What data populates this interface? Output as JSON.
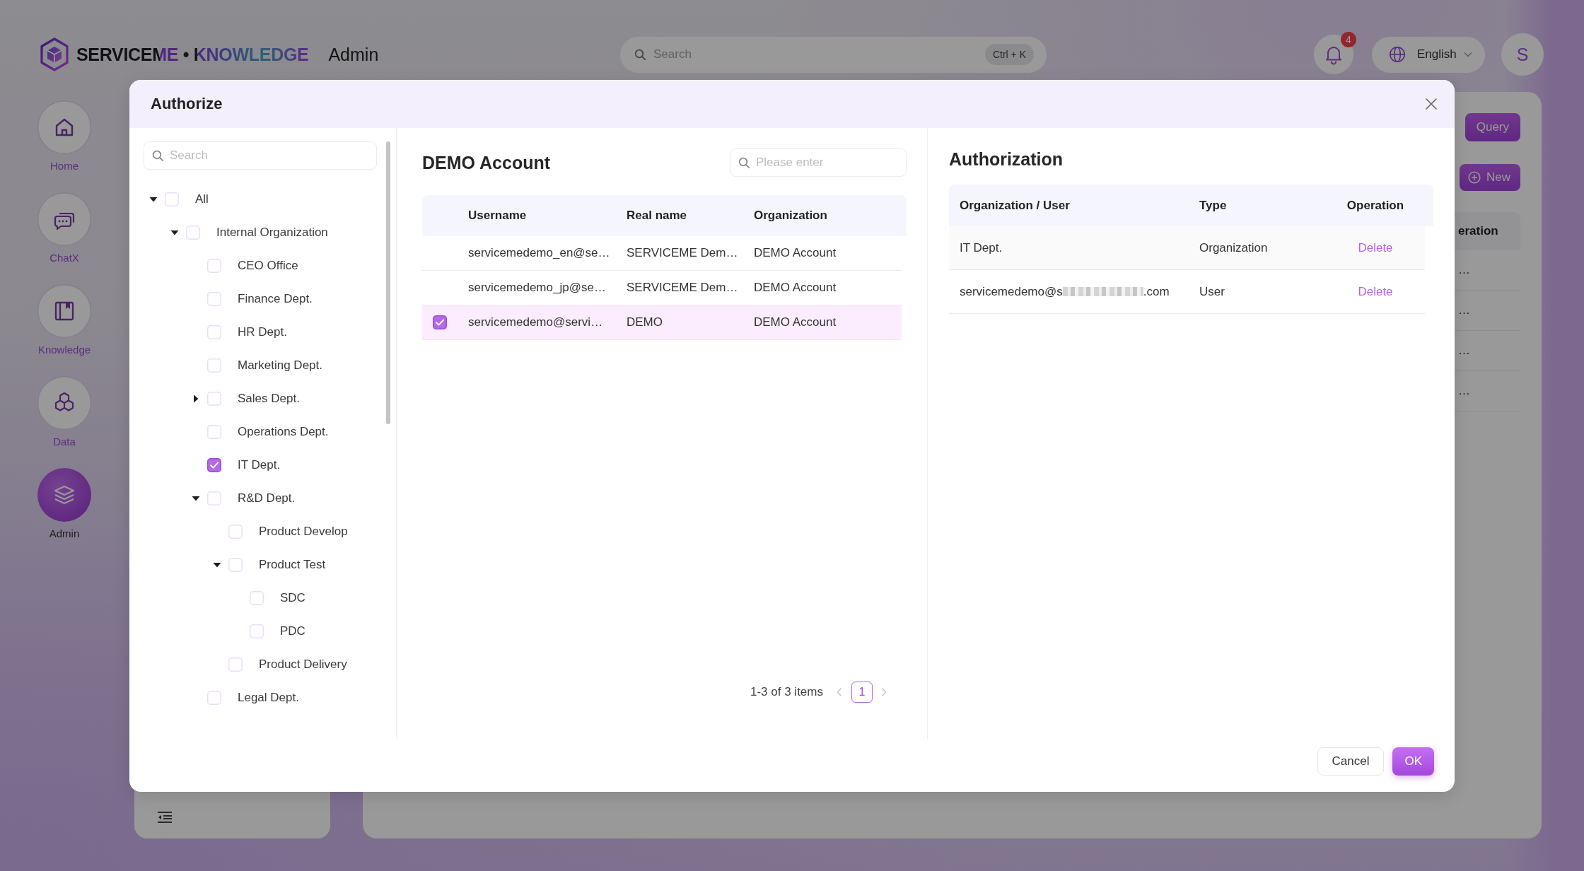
{
  "header": {
    "logo": "SERVICEME • KNOWLEDGE",
    "section": "Admin",
    "search": {
      "placeholder": "Search",
      "shortcut": "Ctrl + K"
    },
    "notifications": {
      "count": "4"
    },
    "language": {
      "label": "English"
    },
    "avatar": {
      "initial": "S"
    }
  },
  "nav": [
    {
      "label": "Home",
      "kind": "home",
      "selected": false
    },
    {
      "label": "ChatX",
      "kind": "chat",
      "selected": false
    },
    {
      "label": "Knowledge",
      "kind": "book",
      "selected": false
    },
    {
      "label": "Data",
      "kind": "hexagons",
      "selected": false
    },
    {
      "label": "Admin",
      "kind": "layers",
      "selected": true
    }
  ],
  "main_panel": {
    "buttons": [
      {
        "label": "Query",
        "kind": "query"
      },
      {
        "label": "New",
        "kind": "create"
      }
    ],
    "table": {
      "column_last": "eration",
      "rows": [
        {
          "column_last": "…"
        },
        {
          "column_last": "…"
        },
        {
          "column_last": "…"
        },
        {
          "column_last": "…"
        }
      ]
    }
  },
  "dialog": {
    "title": "Authorize",
    "tree": {
      "search": {
        "placeholder": "Search"
      },
      "nodes": [
        {
          "label": "All",
          "kind": "branch",
          "expanded": true,
          "checked": false,
          "children": [
            {
              "label": "Internal Organization",
              "kind": "branch",
              "expanded": true,
              "checked": false,
              "children": [
                {
                  "label": "CEO Office",
                  "kind": "leaf",
                  "checked": false
                },
                {
                  "label": "Finance Dept.",
                  "kind": "leaf",
                  "checked": false
                },
                {
                  "label": "HR Dept.",
                  "kind": "leaf",
                  "checked": false
                },
                {
                  "label": "Marketing Dept.",
                  "kind": "leaf",
                  "checked": false
                },
                {
                  "label": "Sales Dept.",
                  "kind": "branch",
                  "expanded": false,
                  "checked": false
                },
                {
                  "label": "Operations Dept.",
                  "kind": "leaf",
                  "checked": false
                },
                {
                  "label": "IT Dept.",
                  "kind": "leaf",
                  "checked": true
                },
                {
                  "label": "R&D Dept.",
                  "kind": "branch",
                  "expanded": true,
                  "checked": false,
                  "children": [
                    {
                      "label": "Product Develop",
                      "kind": "leaf",
                      "checked": false
                    },
                    {
                      "label": "Product Test",
                      "kind": "branch",
                      "expanded": true,
                      "checked": false,
                      "children": [
                        {
                          "label": "SDC",
                          "kind": "leaf",
                          "checked": false
                        },
                        {
                          "label": "PDC",
                          "kind": "leaf",
                          "checked": false
                        }
                      ]
                    },
                    {
                      "label": "Product Delivery",
                      "kind": "leaf",
                      "checked": false
                    }
                  ]
                },
                {
                  "label": "Legal Dept.",
                  "kind": "leaf",
                  "checked": false
                }
              ]
            }
          ]
        }
      ]
    },
    "accounts": {
      "title": "DEMO Account",
      "search": {
        "placeholder": "Please enter"
      },
      "columns": [
        "Username",
        "Real name",
        "Organization"
      ],
      "rows": [
        {
          "username": "servicemedemo_en@se…",
          "real_name": "SERVICEME Dem…",
          "organization": "DEMO Account",
          "selected": false
        },
        {
          "username": "servicemedemo_jp@se…",
          "real_name": "SERVICEME Dem…",
          "organization": "DEMO Account",
          "selected": false
        },
        {
          "username": "servicemedemo@servi…",
          "real_name": "DEMO",
          "organization": "DEMO Account",
          "selected": true
        }
      ],
      "pagination": {
        "summary": "1-3 of 3 items",
        "previous": {
          "disabled": true
        },
        "pages": [
          {
            "label": "1",
            "selected": true
          }
        ],
        "next": {
          "disabled": true
        }
      }
    },
    "authorization": {
      "title": "Authorization",
      "columns": [
        "Organization / User",
        "Type",
        "Operation"
      ],
      "rows": [
        {
          "name": "IT Dept.",
          "redacted": false,
          "type": "Organization",
          "action": "Delete",
          "highlighted": true
        },
        {
          "name": "servicemedemo@s",
          "redacted": true,
          "name_suffix": ".com",
          "type": "User",
          "action": "Delete",
          "highlighted": false
        }
      ]
    },
    "buttons": [
      {
        "label": "Cancel",
        "kind": "cancel"
      },
      {
        "label": "OK",
        "kind": "confirm"
      }
    ]
  }
}
